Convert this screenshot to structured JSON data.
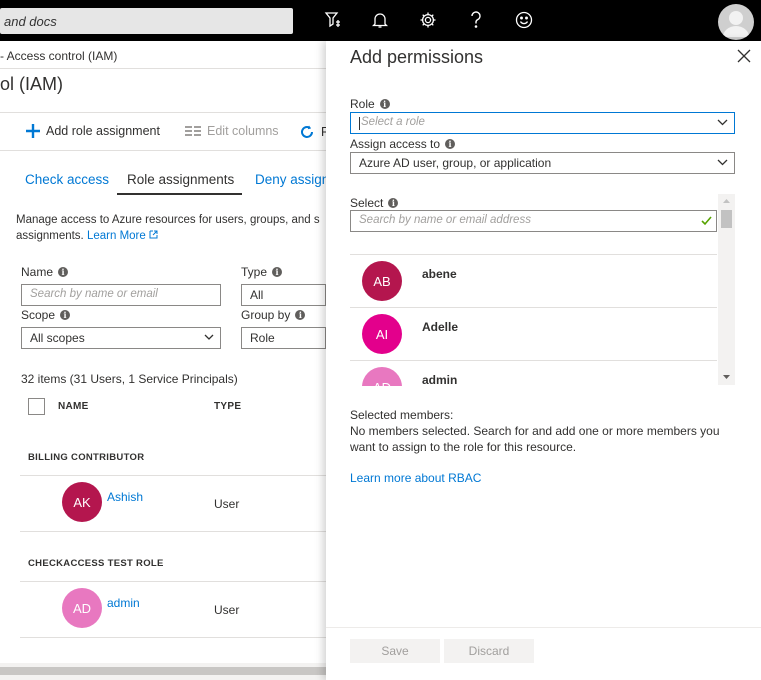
{
  "topbar": {
    "search_text": "and docs",
    "icons": [
      "filter-icon",
      "bell-icon",
      "gear-icon",
      "help-icon",
      "smiley-icon",
      "user-avatar-icon"
    ]
  },
  "blade": {
    "breadcrumb": "- Access control (IAM)",
    "title": "ol (IAM)",
    "commands": {
      "add_role": "Add role assignment",
      "edit_columns": "Edit columns",
      "refresh_partial": "R"
    },
    "tabs": [
      "Check access",
      "Role assignments",
      "Deny assign"
    ],
    "description": "Manage access to Azure resources for users, groups, and s",
    "description_2": "assignments.",
    "learn_more": "Learn More",
    "filters": {
      "name_label": "Name",
      "name_placeholder": "Search by name or email",
      "type_label": "Type",
      "type_value": "All",
      "scope_label": "Scope",
      "scope_value": "All scopes",
      "groupby_label": "Group by",
      "groupby_value": "Role"
    },
    "count": "32 items (31 Users, 1 Service Principals)",
    "columns": [
      "NAME",
      "TYPE"
    ],
    "groups": [
      {
        "label": "BILLING CONTRIBUTOR",
        "initials": "AK",
        "name": "Ashish",
        "type": "User",
        "color": "#b4164e"
      },
      {
        "label": "CHECKACCESS TEST ROLE",
        "initials": "AD",
        "name": "admin",
        "type": "User",
        "color": "#e878c0"
      }
    ]
  },
  "panel": {
    "title": "Add permissions",
    "role_label": "Role",
    "role_placeholder": "Select a role",
    "assign_label": "Assign access to",
    "assign_value": "Azure AD user, group, or application",
    "select_label": "Select",
    "select_placeholder": "Search by name or email address",
    "members": [
      {
        "initials": "AB",
        "name": "abene",
        "color": "#b4164e"
      },
      {
        "initials": "AI",
        "name": "Adelle",
        "color": "#e3008c"
      },
      {
        "initials": "AD",
        "name": "admin",
        "color": "#e878c0"
      }
    ],
    "selected_heading": "Selected members:",
    "selected_text": "No members selected. Search for and add one or more members you want to assign to the role for this resource.",
    "rbac_link": "Learn more about RBAC",
    "save_label": "Save",
    "discard_label": "Discard"
  }
}
